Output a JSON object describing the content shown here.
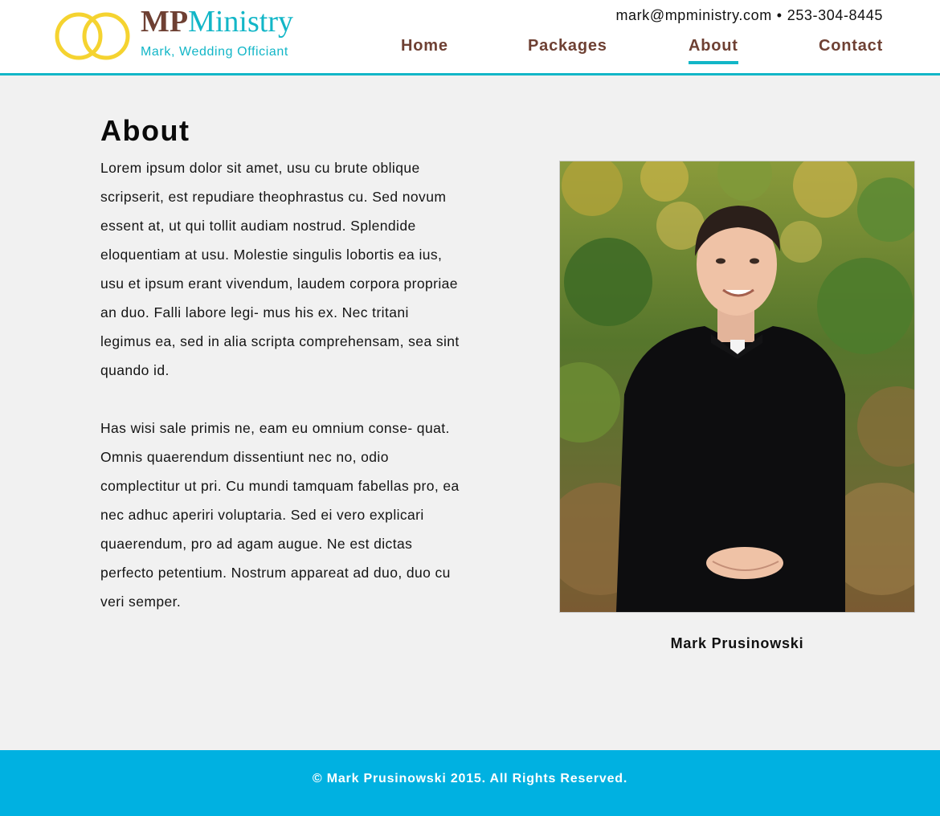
{
  "header": {
    "brand_mp": "MP",
    "brand_ministry": "Ministry",
    "tagline": "Mark, Wedding Officiant",
    "email": "mark@mpministry.com",
    "separator": "•",
    "phone": "253-304-8445",
    "logo_icon": "wedding-rings-icon",
    "nav": [
      {
        "label": "Home",
        "active": false
      },
      {
        "label": "Packages",
        "active": false
      },
      {
        "label": "About",
        "active": true
      },
      {
        "label": "Contact",
        "active": false
      }
    ]
  },
  "main": {
    "title": "About",
    "paragraphs": [
      "Lorem ipsum dolor sit amet, usu cu brute oblique scripserit, est repudiare theophrastus cu. Sed novum essent at, ut qui tollit audiam nostrud. Splendide eloquentiam at usu. Molestie singulis lobortis ea ius, usu et ipsum erant vivendum, laudem corpora propriae an duo. Falli labore legi- mus his ex. Nec tritani legimus ea, sed in alia scripta comprehensam, sea sint quando id.",
      "Has wisi sale primis ne, eam eu omnium conse- quat. Omnis quaerendum dissentiunt nec no, odio complectitur ut pri. Cu mundi tamquam fabellas pro, ea nec adhuc aperiri voluptaria. Sed ei vero explicari quaerendum, pro ad agam augue. Ne est dictas perfecto petentium. Nostrum appareat ad duo, duo cu veri semper."
    ],
    "photo_caption": "Mark Prusinowski"
  },
  "footer": {
    "copyright": "© Mark Prusinowski 2015. All Rights Reserved."
  },
  "colors": {
    "accent_teal": "#12b6c7",
    "brand_brown": "#6e4033",
    "ring_gold": "#f5d330",
    "footer_blue": "#00b1e1",
    "page_bg": "#f1f1f1"
  }
}
